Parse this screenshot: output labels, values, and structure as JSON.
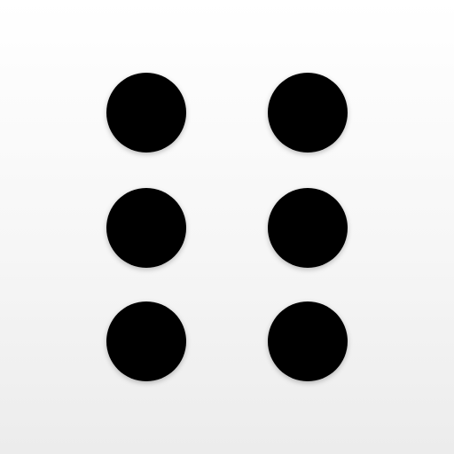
{
  "icon": {
    "name": "braille-six-dots",
    "background_top": "#ffffff",
    "background_bottom": "#ececec",
    "dot_color": "#000000",
    "dots": [
      {
        "name": "dot-1",
        "filled": true
      },
      {
        "name": "dot-2",
        "filled": true
      },
      {
        "name": "dot-3",
        "filled": true
      },
      {
        "name": "dot-4",
        "filled": true
      },
      {
        "name": "dot-5",
        "filled": true
      },
      {
        "name": "dot-6",
        "filled": true
      }
    ]
  }
}
